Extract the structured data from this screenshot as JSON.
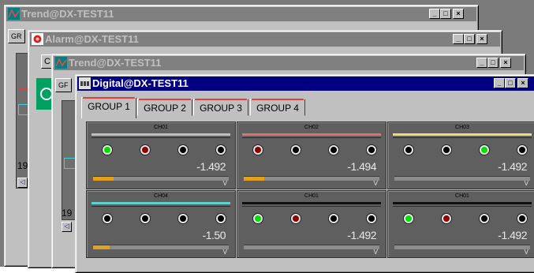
{
  "colors": {
    "active_title": "#000080",
    "inactive_title": "#808080",
    "led_green": "#00e000",
    "led_red": "#8b0000",
    "bar": "#e0a020"
  },
  "windows": {
    "trend1": {
      "title": "Trend@DX-TEST11",
      "partial_tab": "GR",
      "number": "19"
    },
    "alarm": {
      "title": "Alarm@DX-TEST11",
      "partial_tab": "C"
    },
    "trend2": {
      "title": "Trend@DX-TEST11",
      "partial_tab": "GF",
      "number": "19"
    },
    "digital": {
      "title": "Digital@DX-TEST11"
    }
  },
  "buttons": {
    "minimize": "_",
    "maximize": "□",
    "close": "×",
    "scroll_left": "◁"
  },
  "tabs": [
    "GROUP 1",
    "GROUP 2",
    "GROUP 3",
    "GROUP 4"
  ],
  "channels": [
    {
      "name": "CH01",
      "line_color": "#c0c0c0",
      "leds": [
        "green",
        "red",
        "black",
        "black"
      ],
      "value": "-1.492",
      "unit": "V",
      "bar": 0.15
    },
    {
      "name": "CH02",
      "line_color": "#e07070",
      "leds": [
        "red",
        "black",
        "black",
        "black"
      ],
      "value": "-1.494",
      "unit": "V",
      "bar": 0.15
    },
    {
      "name": "CH03",
      "line_color": "#e8e070",
      "leds": [
        "black",
        "black",
        "green",
        "black"
      ],
      "value": "-1.492",
      "unit": "V",
      "bar": 0
    },
    {
      "name": "CH04",
      "line_color": "#60d0d0",
      "leds": [
        "black",
        "black",
        "black",
        "black"
      ],
      "value": "-1.50",
      "unit": "V",
      "bar": 0.12
    },
    {
      "name": "CH01",
      "line_color": "#101010",
      "leds": [
        "green",
        "red",
        "black",
        "black"
      ],
      "value": "-1.492",
      "unit": "V",
      "bar": 0
    },
    {
      "name": "CH01",
      "line_color": "#101010",
      "leds": [
        "green",
        "red",
        "black",
        "black"
      ],
      "value": "-1.492",
      "unit": "V",
      "bar": 0
    }
  ]
}
